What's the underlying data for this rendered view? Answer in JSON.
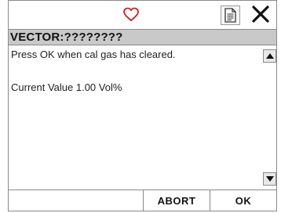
{
  "header": {
    "status_icon": "heart-icon",
    "report_icon": "document-icon",
    "close_icon": "close-icon",
    "accent_color": "#cc2222"
  },
  "titlebar": {
    "title": "VECTOR:????????"
  },
  "content": {
    "message": "Press OK when cal gas has cleared.",
    "value_line": "Current Value  1.00 Vol%"
  },
  "footer": {
    "abort_label": "ABORT",
    "ok_label": "OK"
  }
}
